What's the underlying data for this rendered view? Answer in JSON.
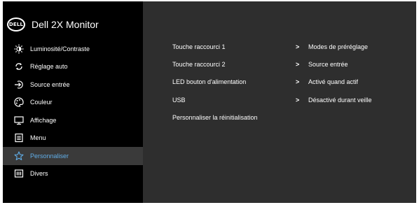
{
  "header": {
    "logo_text": "DELL",
    "title": "Dell 2X Monitor"
  },
  "menu": [
    {
      "label": "Luminosité/Contraste",
      "icon": "brightness-icon"
    },
    {
      "label": "Réglage auto",
      "icon": "auto-adjust-icon"
    },
    {
      "label": "Source entrée",
      "icon": "input-source-icon"
    },
    {
      "label": "Couleur",
      "icon": "color-icon"
    },
    {
      "label": "Affichage",
      "icon": "display-icon"
    },
    {
      "label": "Menu",
      "icon": "menu-icon"
    },
    {
      "label": "Personnaliser",
      "icon": "star-icon",
      "selected": true
    },
    {
      "label": "Divers",
      "icon": "others-icon"
    }
  ],
  "settings": [
    {
      "label": "Touche raccourci 1",
      "chevron": ">",
      "value": "Modes de préréglage"
    },
    {
      "label": "Touche raccourci 2",
      "chevron": ">",
      "value": "Source entrée"
    },
    {
      "label": "LED bouton d'alimentation",
      "chevron": ">",
      "value": "Activé quand actif"
    },
    {
      "label": "USB",
      "chevron": ">",
      "value": "Désactivé durant veille"
    },
    {
      "label": "Personnaliser la réinitialisation"
    }
  ],
  "colors": {
    "selected_text": "#61aee8",
    "panel_bg": "#2e2e2e",
    "sidebar_bg": "#000000"
  }
}
